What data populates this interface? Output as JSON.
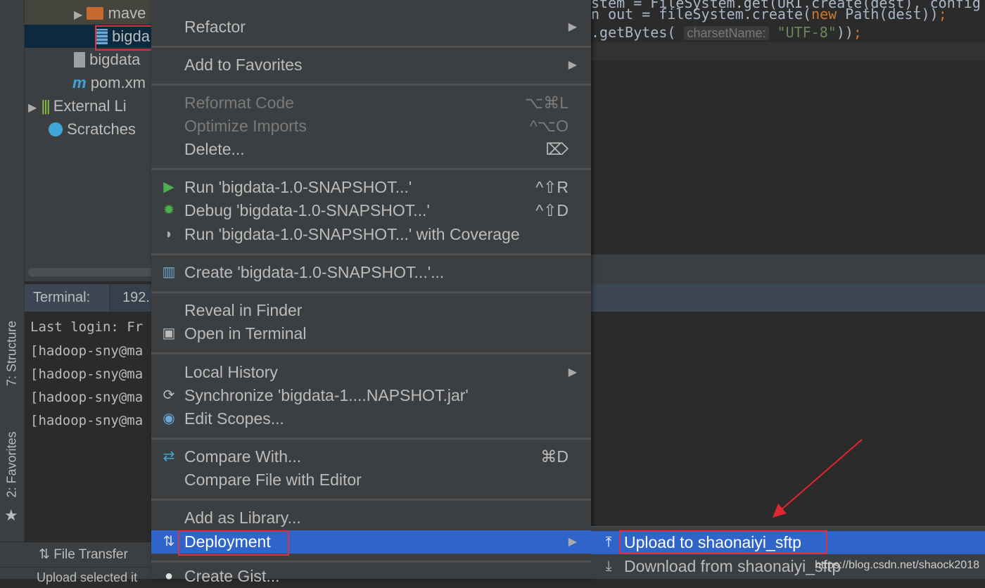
{
  "project_tree": {
    "items": [
      {
        "label": "mave",
        "icon": "folder-icon"
      },
      {
        "label": "bigda",
        "icon": "jar-icon",
        "selected": true
      },
      {
        "label": "bigdata",
        "icon": "file-icon"
      },
      {
        "label": "pom.xm",
        "icon": "maven-icon"
      },
      {
        "label": "External Li",
        "icon": "library-icon"
      },
      {
        "label": "Scratches",
        "icon": "scratches-icon"
      }
    ]
  },
  "editor": {
    "lines": [
      {
        "parts": [
          {
            "t": "stem = FileSystem.get(URI.create(dest), config",
            "c": "#a9b7c6"
          }
        ]
      },
      {
        "parts": [
          {
            "t": "n out = fileSystem.create(",
            "c": "#a9b7c6"
          },
          {
            "t": "new",
            "c": "#cc7832"
          },
          {
            "t": " Path(dest))",
            "c": "#a9b7c6"
          },
          {
            "t": ";",
            "c": "#cc7832"
          }
        ]
      },
      {
        "parts": [
          {
            "t": ".getBytes( ",
            "c": "#a9b7c6"
          },
          {
            "t": "charsetName:",
            "c": "#787878",
            "hint": true
          },
          {
            "t": " \"UTF-8\"",
            "c": "#6a8759"
          },
          {
            "t": "))",
            "c": "#a9b7c6"
          },
          {
            "t": ";",
            "c": "#cc7832"
          }
        ]
      }
    ]
  },
  "side_tabs": {
    "structure": "7: Structure",
    "favorites": "2: Favorites"
  },
  "terminal": {
    "label": "Terminal:",
    "tab": "192.",
    "lines": [
      "Last login: Fr",
      "[hadoop-sny@ma",
      "[hadoop-sny@ma",
      "[hadoop-sny@ma",
      "[hadoop-sny@ma"
    ]
  },
  "statusbar": {
    "file_transfer": "File Transfer",
    "bottom_text": "Upload selected it"
  },
  "context_menu": {
    "items": [
      {
        "label": "Refactor",
        "submenu": true
      },
      {
        "label": "Add to Favorites",
        "submenu": true
      },
      {
        "label": "Reformat Code",
        "shortcut": "⌥⌘L",
        "disabled": true
      },
      {
        "label": "Optimize Imports",
        "shortcut": "^⌥O",
        "disabled": true
      },
      {
        "label": "Delete...",
        "shortcut": "⌦"
      },
      {
        "label": "Run 'bigdata-1.0-SNAPSHOT...'",
        "shortcut": "^⇧R",
        "icon": "run-icon"
      },
      {
        "label": "Debug 'bigdata-1.0-SNAPSHOT...'",
        "shortcut": "^⇧D",
        "icon": "debug-icon"
      },
      {
        "label": "Run 'bigdata-1.0-SNAPSHOT...' with Coverage",
        "icon": "coverage-icon"
      },
      {
        "label": "Create 'bigdata-1.0-SNAPSHOT...'...",
        "icon": "jar-icon"
      },
      {
        "label": "Reveal in Finder"
      },
      {
        "label": "Open in Terminal",
        "icon": "terminal-icon"
      },
      {
        "label": "Local History",
        "submenu": true
      },
      {
        "label": "Synchronize 'bigdata-1....NAPSHOT.jar'",
        "icon": "sync-icon"
      },
      {
        "label": "Edit Scopes...",
        "icon": "scope-icon"
      },
      {
        "label": "Compare With...",
        "shortcut": "⌘D",
        "icon": "compare-icon"
      },
      {
        "label": "Compare File with Editor"
      },
      {
        "label": "Add as Library..."
      },
      {
        "label": "Deployment",
        "submenu": true,
        "selected": true,
        "icon": "deployment-icon"
      },
      {
        "label": "Create Gist...",
        "icon": "github-icon"
      }
    ]
  },
  "deployment_submenu": {
    "items": [
      {
        "label": "Upload to shaonaiyi_sftp",
        "icon": "upload-icon",
        "selected": true
      },
      {
        "label": "Download from shaonaiyi_sftp",
        "icon": "download-icon"
      }
    ]
  },
  "watermark": "https://blog.csdn.net/shaock2018",
  "colors": {
    "selection": "#2f65ca",
    "highlight_box": "#d9333f",
    "annotation_arrow": "#e0262f"
  }
}
